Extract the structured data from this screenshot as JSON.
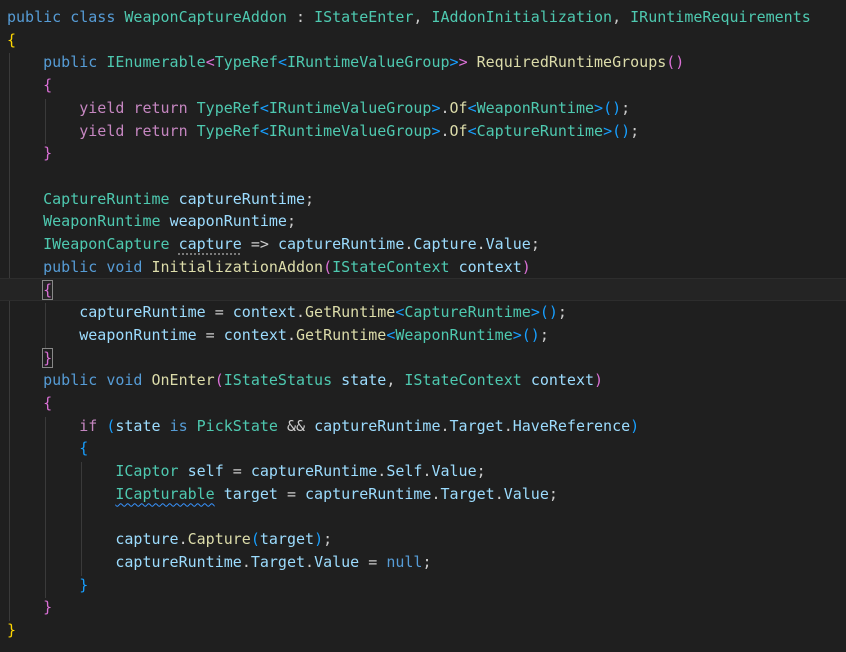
{
  "editor": {
    "lines": [
      [
        [
          "kw",
          "public"
        ],
        [
          "txt",
          " "
        ],
        [
          "kw",
          "class"
        ],
        [
          "txt",
          " "
        ],
        [
          "type",
          "WeaponCaptureAddon"
        ],
        [
          "txt",
          " : "
        ],
        [
          "type",
          "IStateEnter"
        ],
        [
          "txt",
          ", "
        ],
        [
          "type",
          "IAddonInitialization"
        ],
        [
          "txt",
          ", "
        ],
        [
          "type",
          "IRuntimeRequirements"
        ]
      ],
      [
        [
          "p1",
          "{"
        ]
      ],
      [
        [
          "txt",
          "    "
        ],
        [
          "kw",
          "public"
        ],
        [
          "txt",
          " "
        ],
        [
          "type",
          "IEnumerable"
        ],
        [
          "p2",
          "<"
        ],
        [
          "type",
          "TypeRef"
        ],
        [
          "p3",
          "<"
        ],
        [
          "type",
          "IRuntimeValueGroup"
        ],
        [
          "p3",
          ">"
        ],
        [
          "p2",
          ">"
        ],
        [
          "txt",
          " "
        ],
        [
          "fn",
          "RequiredRuntimeGroups"
        ],
        [
          "p2",
          "()"
        ]
      ],
      [
        [
          "txt",
          "    "
        ],
        [
          "p2",
          "{"
        ]
      ],
      [
        [
          "txt",
          "        "
        ],
        [
          "ctl",
          "yield"
        ],
        [
          "txt",
          " "
        ],
        [
          "ctl",
          "return"
        ],
        [
          "txt",
          " "
        ],
        [
          "type",
          "TypeRef"
        ],
        [
          "p3",
          "<"
        ],
        [
          "type",
          "IRuntimeValueGroup"
        ],
        [
          "p3",
          ">"
        ],
        [
          "txt",
          "."
        ],
        [
          "fn",
          "Of"
        ],
        [
          "p3",
          "<"
        ],
        [
          "type",
          "WeaponRuntime"
        ],
        [
          "p3",
          ">"
        ],
        [
          "p3",
          "()"
        ],
        [
          "txt",
          ";"
        ]
      ],
      [
        [
          "txt",
          "        "
        ],
        [
          "ctl",
          "yield"
        ],
        [
          "txt",
          " "
        ],
        [
          "ctl",
          "return"
        ],
        [
          "txt",
          " "
        ],
        [
          "type",
          "TypeRef"
        ],
        [
          "p3",
          "<"
        ],
        [
          "type",
          "IRuntimeValueGroup"
        ],
        [
          "p3",
          ">"
        ],
        [
          "txt",
          "."
        ],
        [
          "fn",
          "Of"
        ],
        [
          "p3",
          "<"
        ],
        [
          "type",
          "CaptureRuntime"
        ],
        [
          "p3",
          ">"
        ],
        [
          "p3",
          "()"
        ],
        [
          "txt",
          ";"
        ]
      ],
      [
        [
          "txt",
          "    "
        ],
        [
          "p2",
          "}"
        ]
      ],
      [],
      [
        [
          "txt",
          "    "
        ],
        [
          "type",
          "CaptureRuntime"
        ],
        [
          "txt",
          " "
        ],
        [
          "var",
          "captureRuntime"
        ],
        [
          "txt",
          ";"
        ]
      ],
      [
        [
          "txt",
          "    "
        ],
        [
          "type",
          "WeaponRuntime"
        ],
        [
          "txt",
          " "
        ],
        [
          "var",
          "weaponRuntime"
        ],
        [
          "txt",
          ";"
        ]
      ],
      [
        [
          "txt",
          "    "
        ],
        [
          "type",
          "IWeaponCapture"
        ],
        [
          "txt",
          " "
        ],
        [
          "var",
          "capture"
        ],
        [
          "txt",
          " => "
        ],
        [
          "var",
          "captureRuntime"
        ],
        [
          "txt",
          "."
        ],
        [
          "var",
          "Capture"
        ],
        [
          "txt",
          "."
        ],
        [
          "var",
          "Value"
        ],
        [
          "txt",
          ";"
        ]
      ],
      [
        [
          "txt",
          "    "
        ],
        [
          "kw",
          "public"
        ],
        [
          "txt",
          " "
        ],
        [
          "kw",
          "void"
        ],
        [
          "txt",
          " "
        ],
        [
          "fn",
          "InitializationAddon"
        ],
        [
          "p2",
          "("
        ],
        [
          "type",
          "IStateContext"
        ],
        [
          "txt",
          " "
        ],
        [
          "var",
          "context"
        ],
        [
          "p2",
          ")"
        ]
      ],
      [
        [
          "txt",
          "    "
        ],
        [
          "p2",
          "{"
        ]
      ],
      [
        [
          "txt",
          "        "
        ],
        [
          "var",
          "captureRuntime"
        ],
        [
          "txt",
          " = "
        ],
        [
          "var",
          "context"
        ],
        [
          "txt",
          "."
        ],
        [
          "fn",
          "GetRuntime"
        ],
        [
          "p3",
          "<"
        ],
        [
          "type",
          "CaptureRuntime"
        ],
        [
          "p3",
          ">"
        ],
        [
          "p3",
          "()"
        ],
        [
          "txt",
          ";"
        ]
      ],
      [
        [
          "txt",
          "        "
        ],
        [
          "var",
          "weaponRuntime"
        ],
        [
          "txt",
          " = "
        ],
        [
          "var",
          "context"
        ],
        [
          "txt",
          "."
        ],
        [
          "fn",
          "GetRuntime"
        ],
        [
          "p3",
          "<"
        ],
        [
          "type",
          "WeaponRuntime"
        ],
        [
          "p3",
          ">"
        ],
        [
          "p3",
          "()"
        ],
        [
          "txt",
          ";"
        ]
      ],
      [
        [
          "txt",
          "    "
        ],
        [
          "p2",
          "}"
        ]
      ],
      [
        [
          "txt",
          "    "
        ],
        [
          "kw",
          "public"
        ],
        [
          "txt",
          " "
        ],
        [
          "kw",
          "void"
        ],
        [
          "txt",
          " "
        ],
        [
          "fn",
          "OnEnter"
        ],
        [
          "p2",
          "("
        ],
        [
          "type",
          "IStateStatus"
        ],
        [
          "txt",
          " "
        ],
        [
          "var",
          "state"
        ],
        [
          "txt",
          ", "
        ],
        [
          "type",
          "IStateContext"
        ],
        [
          "txt",
          " "
        ],
        [
          "var",
          "context"
        ],
        [
          "p2",
          ")"
        ]
      ],
      [
        [
          "txt",
          "    "
        ],
        [
          "p2",
          "{"
        ]
      ],
      [
        [
          "txt",
          "        "
        ],
        [
          "ctl",
          "if"
        ],
        [
          "txt",
          " "
        ],
        [
          "p3",
          "("
        ],
        [
          "var",
          "state"
        ],
        [
          "txt",
          " "
        ],
        [
          "kw",
          "is"
        ],
        [
          "txt",
          " "
        ],
        [
          "type",
          "PickState"
        ],
        [
          "txt",
          " && "
        ],
        [
          "var",
          "captureRuntime"
        ],
        [
          "txt",
          "."
        ],
        [
          "var",
          "Target"
        ],
        [
          "txt",
          "."
        ],
        [
          "var",
          "HaveReference"
        ],
        [
          "p3",
          ")"
        ]
      ],
      [
        [
          "txt",
          "        "
        ],
        [
          "p3",
          "{"
        ]
      ],
      [
        [
          "txt",
          "            "
        ],
        [
          "type",
          "ICaptor"
        ],
        [
          "txt",
          " "
        ],
        [
          "var",
          "self"
        ],
        [
          "txt",
          " = "
        ],
        [
          "var",
          "captureRuntime"
        ],
        [
          "txt",
          "."
        ],
        [
          "var",
          "Self"
        ],
        [
          "txt",
          "."
        ],
        [
          "var",
          "Value"
        ],
        [
          "txt",
          ";"
        ]
      ],
      [
        [
          "txt",
          "            "
        ],
        [
          "type",
          "ICapturable"
        ],
        [
          "txt",
          " "
        ],
        [
          "var",
          "target"
        ],
        [
          "txt",
          " = "
        ],
        [
          "var",
          "captureRuntime"
        ],
        [
          "txt",
          "."
        ],
        [
          "var",
          "Target"
        ],
        [
          "txt",
          "."
        ],
        [
          "var",
          "Value"
        ],
        [
          "txt",
          ";"
        ]
      ],
      [],
      [
        [
          "txt",
          "            "
        ],
        [
          "var",
          "capture"
        ],
        [
          "txt",
          "."
        ],
        [
          "fn",
          "Capture"
        ],
        [
          "p3",
          "("
        ],
        [
          "var",
          "target"
        ],
        [
          "p3",
          ")"
        ],
        [
          "txt",
          ";"
        ]
      ],
      [
        [
          "txt",
          "            "
        ],
        [
          "var",
          "captureRuntime"
        ],
        [
          "txt",
          "."
        ],
        [
          "var",
          "Target"
        ],
        [
          "txt",
          "."
        ],
        [
          "var",
          "Value"
        ],
        [
          "txt",
          " = "
        ],
        [
          "kw",
          "null"
        ],
        [
          "txt",
          ";"
        ]
      ],
      [
        [
          "txt",
          "        "
        ],
        [
          "p3",
          "}"
        ]
      ],
      [
        [
          "txt",
          "    "
        ],
        [
          "p2",
          "}"
        ]
      ],
      [
        [
          "p1",
          "}"
        ]
      ]
    ]
  },
  "colors": {
    "background": "#1f1f1f",
    "keyword": "#569cd6",
    "control_keyword": "#c586c0",
    "type": "#4ec9b0",
    "method": "#dcdcaa",
    "variable": "#9cdcfe",
    "bracket_level_1": "#ffd700",
    "bracket_level_2": "#da70d6",
    "bracket_level_3": "#179fff"
  }
}
